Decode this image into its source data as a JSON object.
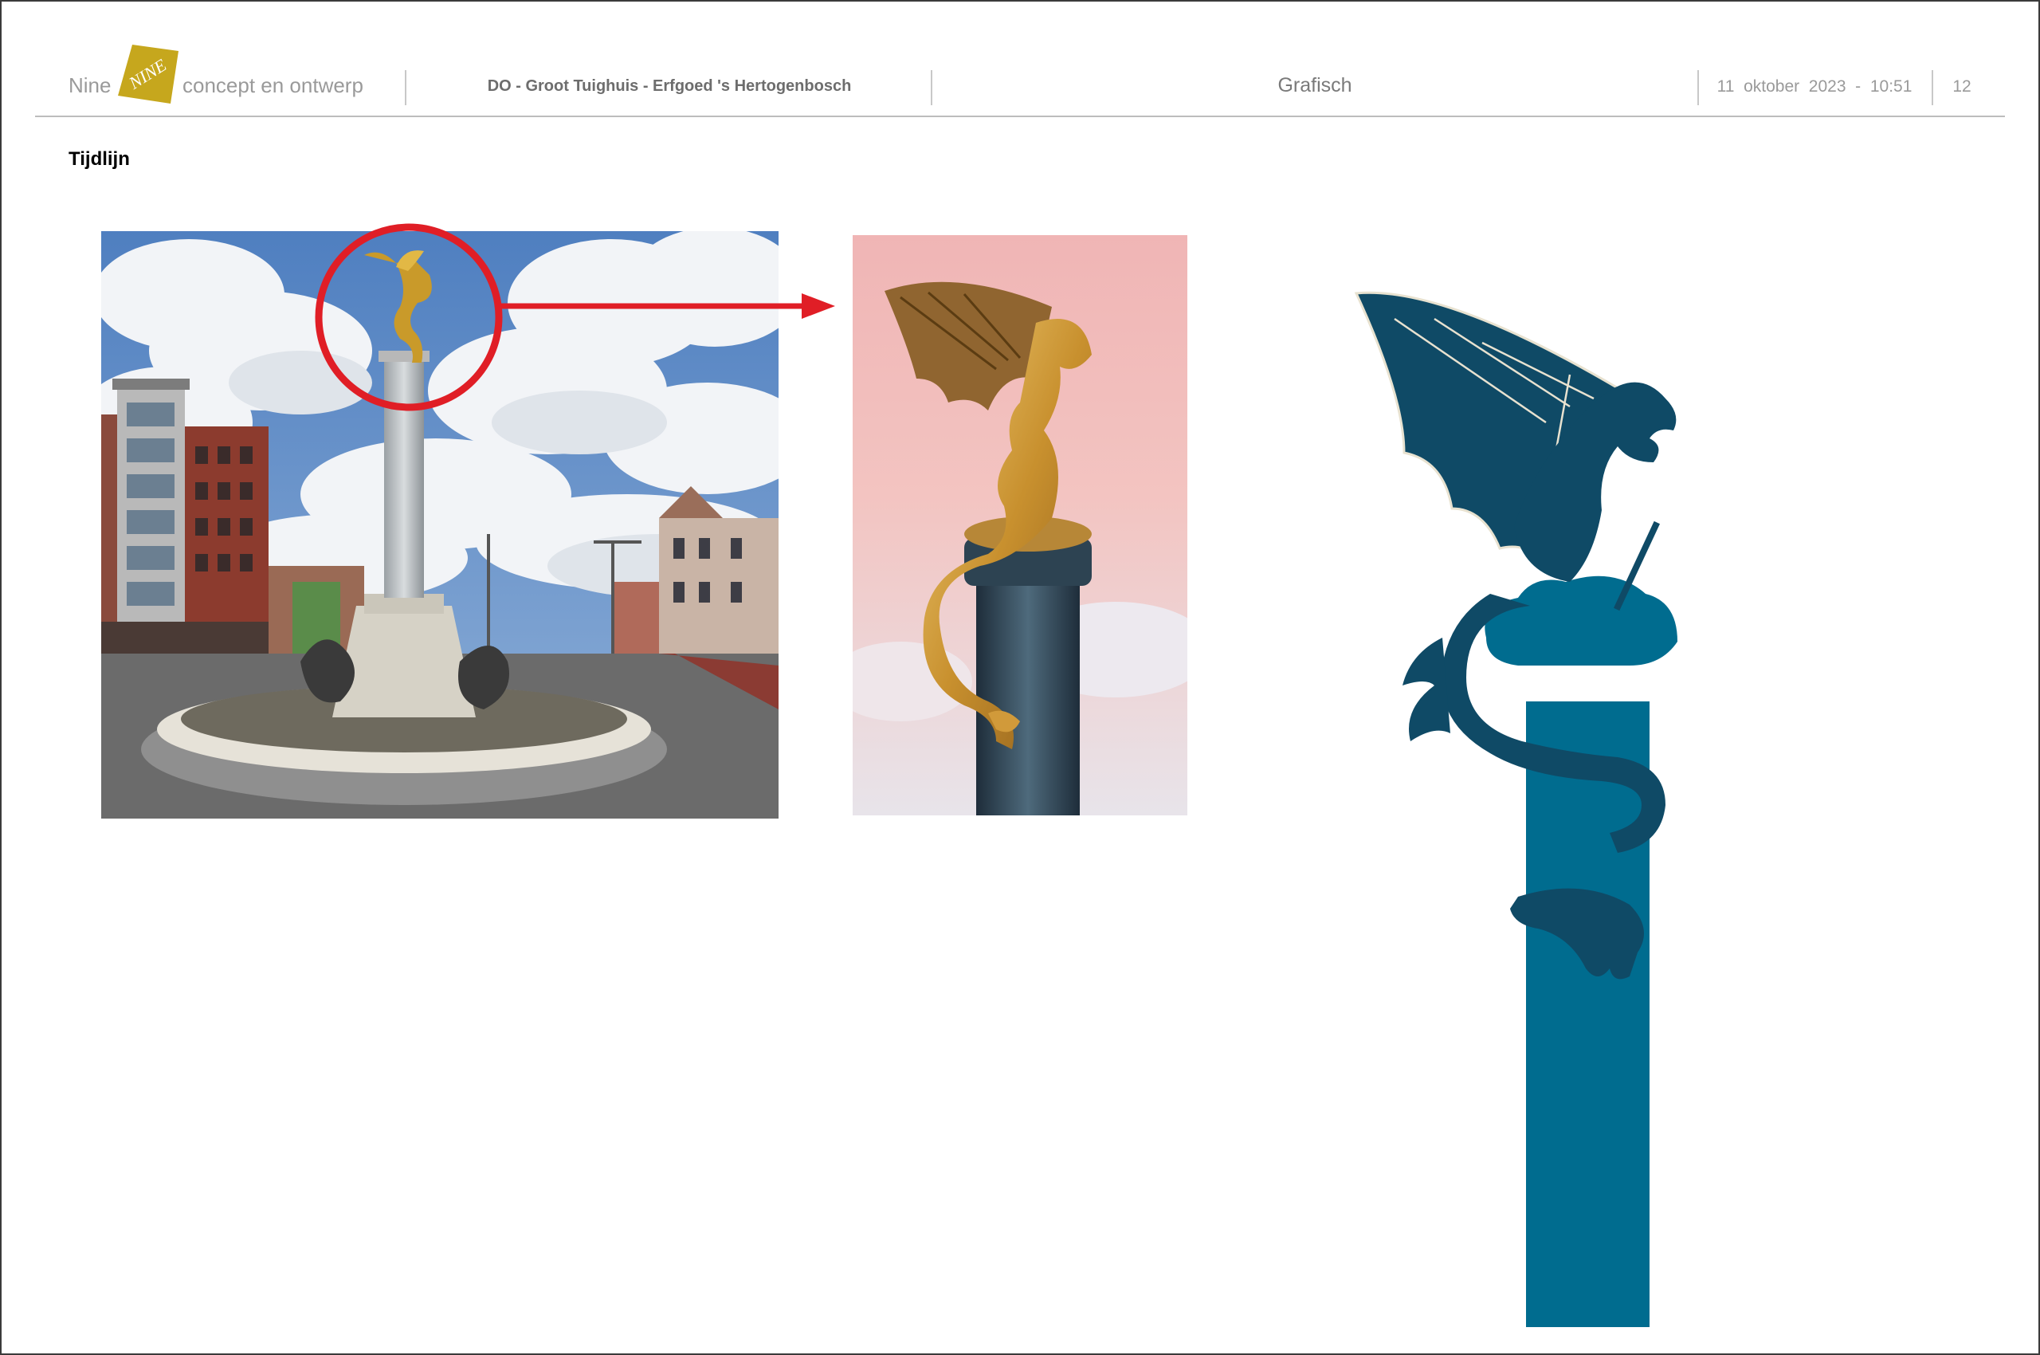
{
  "header": {
    "brand_left": "Nine",
    "brand_logo_text": "NINE",
    "brand_right": "concept en ontwerp",
    "project": "DO - Groot Tuighuis - Erfgoed 's Hertogenbosch",
    "section": "Grafisch",
    "datetime": "11  oktober  2023  -  10:51",
    "page_number": "12"
  },
  "content": {
    "heading": "Tijdlijn"
  },
  "colors": {
    "brand_logo": "#c6a71d",
    "annotation_red": "#e01e26",
    "dragon_dark": "#0f4a66",
    "column_teal": "#006c8f"
  },
  "images": [
    {
      "name": "fountain-photo",
      "subject": "dragon fountain column on roundabout"
    },
    {
      "name": "dragon-statue-photo",
      "subject": "golden dragon on column, close-up"
    },
    {
      "name": "dragon-column-graphic",
      "subject": "blue dragon on column illustration"
    }
  ]
}
